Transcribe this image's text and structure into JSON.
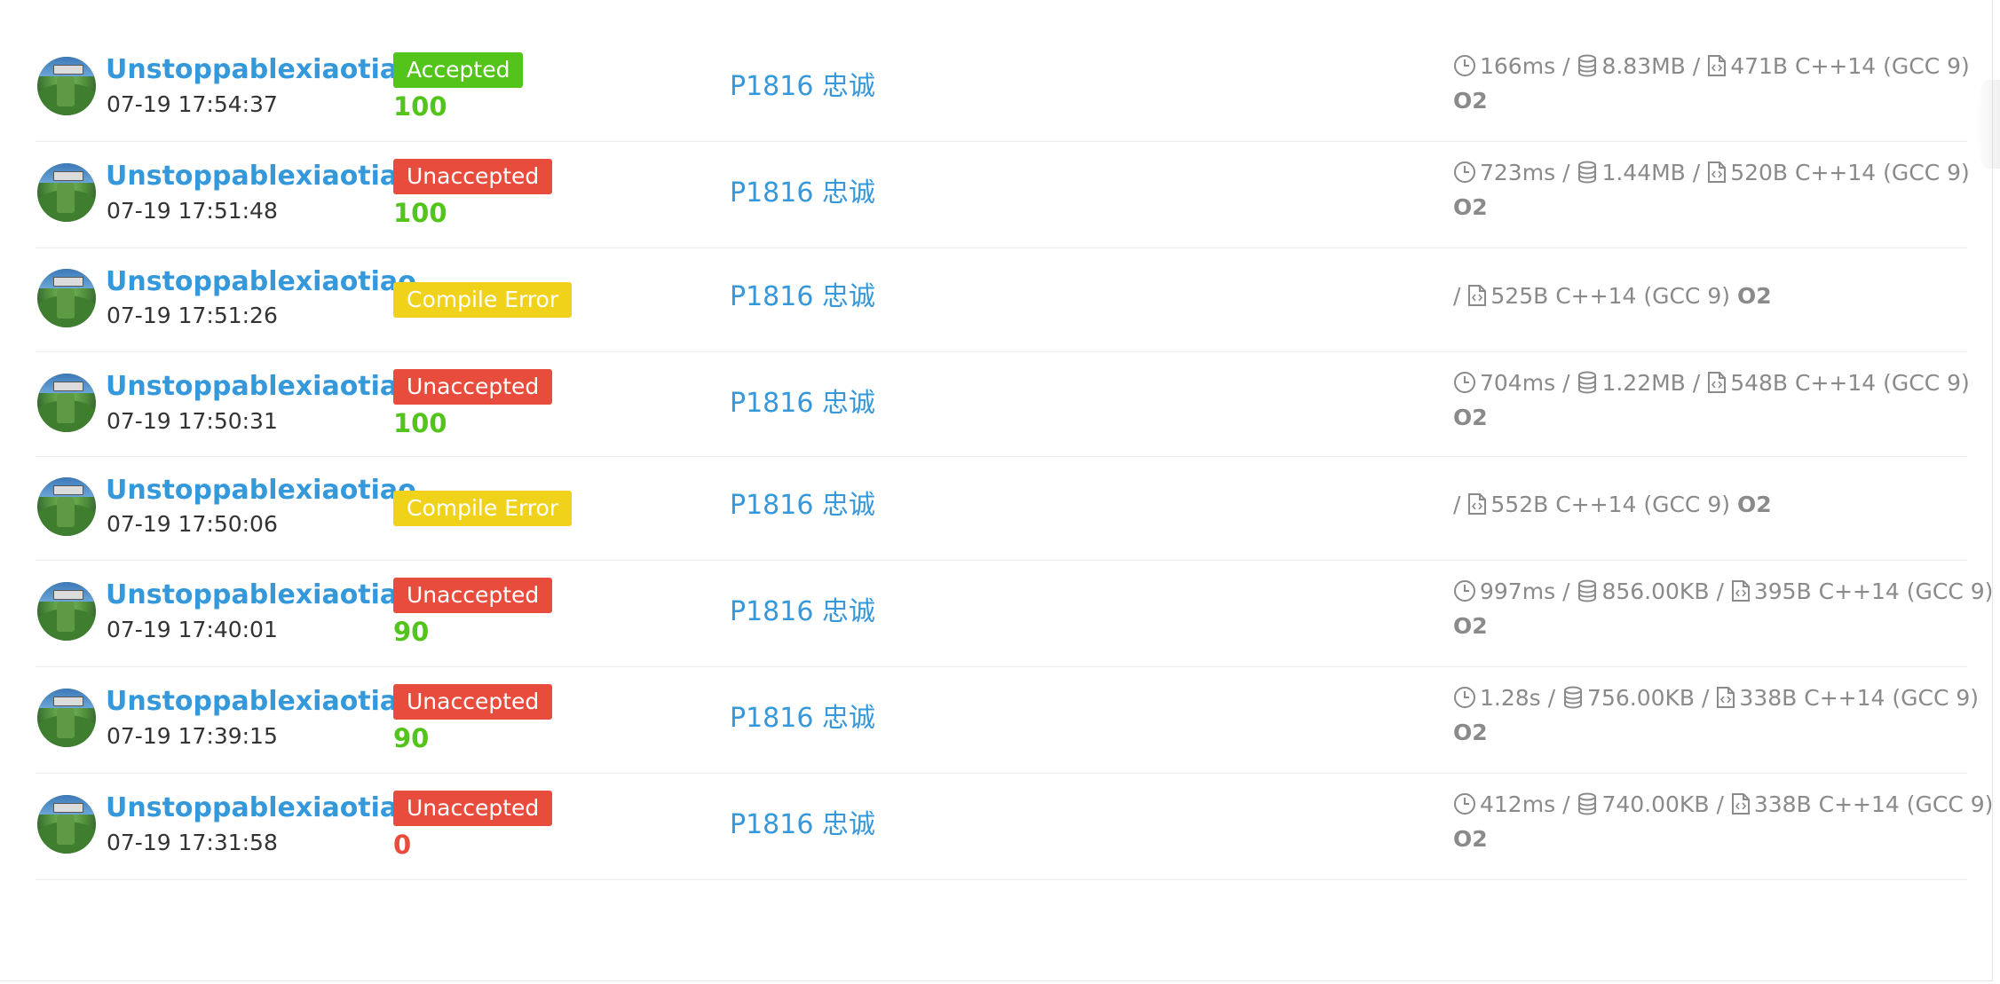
{
  "colors": {
    "link": "#3498db",
    "accepted": "#52c41a",
    "unaccepted": "#e74c3c",
    "compile_error": "#f1d21b",
    "score_pass": "#52c41a",
    "score_fail": "#e74c3c",
    "meta_text": "#8a8a8a"
  },
  "icons": {
    "time": "clock-icon",
    "memory": "database-icon",
    "code": "code-file-icon"
  },
  "records": [
    {
      "user": "Unstoppablexiaotiao",
      "time": "07-19 17:54:37",
      "status": "Accepted",
      "status_type": "accepted",
      "score": "100",
      "score_type": "pass",
      "problem": "P1816 忠诚",
      "runtime": "166ms",
      "memory": "8.83MB",
      "code_size": "471B",
      "language": "C++14 (GCC 9)",
      "sep": "/",
      "opt": "O2"
    },
    {
      "user": "Unstoppablexiaotiao",
      "time": "07-19 17:51:48",
      "status": "Unaccepted",
      "status_type": "unaccepted",
      "score": "100",
      "score_type": "pass",
      "problem": "P1816 忠诚",
      "runtime": "723ms",
      "memory": "1.44MB",
      "code_size": "520B",
      "language": "C++14 (GCC 9)",
      "sep": "/",
      "opt": "O2"
    },
    {
      "user": "Unstoppablexiaotiao",
      "time": "07-19 17:51:26",
      "status": "Compile Error",
      "status_type": "compile_error",
      "problem": "P1816 忠诚",
      "code_size": "525B",
      "language": "C++14 (GCC 9)",
      "sep": "/",
      "opt": "O2"
    },
    {
      "user": "Unstoppablexiaotiao",
      "time": "07-19 17:50:31",
      "status": "Unaccepted",
      "status_type": "unaccepted",
      "score": "100",
      "score_type": "pass",
      "problem": "P1816 忠诚",
      "runtime": "704ms",
      "memory": "1.22MB",
      "code_size": "548B",
      "language": "C++14 (GCC 9)",
      "sep": "/",
      "opt": "O2"
    },
    {
      "user": "Unstoppablexiaotiao",
      "time": "07-19 17:50:06",
      "status": "Compile Error",
      "status_type": "compile_error",
      "problem": "P1816 忠诚",
      "code_size": "552B",
      "language": "C++14 (GCC 9)",
      "sep": "/",
      "opt": "O2"
    },
    {
      "user": "Unstoppablexiaotiao",
      "time": "07-19 17:40:01",
      "status": "Unaccepted",
      "status_type": "unaccepted",
      "score": "90",
      "score_type": "pass",
      "problem": "P1816 忠诚",
      "runtime": "997ms",
      "memory": "856.00KB",
      "code_size": "395B",
      "language": "C++14 (GCC 9)",
      "sep": "/",
      "opt": "O2"
    },
    {
      "user": "Unstoppablexiaotiao",
      "time": "07-19 17:39:15",
      "status": "Unaccepted",
      "status_type": "unaccepted",
      "score": "90",
      "score_type": "pass",
      "problem": "P1816 忠诚",
      "runtime": "1.28s",
      "memory": "756.00KB",
      "code_size": "338B",
      "language": "C++14 (GCC 9)",
      "sep": "/",
      "opt": "O2"
    },
    {
      "user": "Unstoppablexiaotiao",
      "time": "07-19 17:31:58",
      "status": "Unaccepted",
      "status_type": "unaccepted",
      "score": "0",
      "score_type": "fail",
      "problem": "P1816 忠诚",
      "runtime": "412ms",
      "memory": "740.00KB",
      "code_size": "338B",
      "language": "C++14 (GCC 9)",
      "sep": "/",
      "opt": "O2"
    }
  ]
}
